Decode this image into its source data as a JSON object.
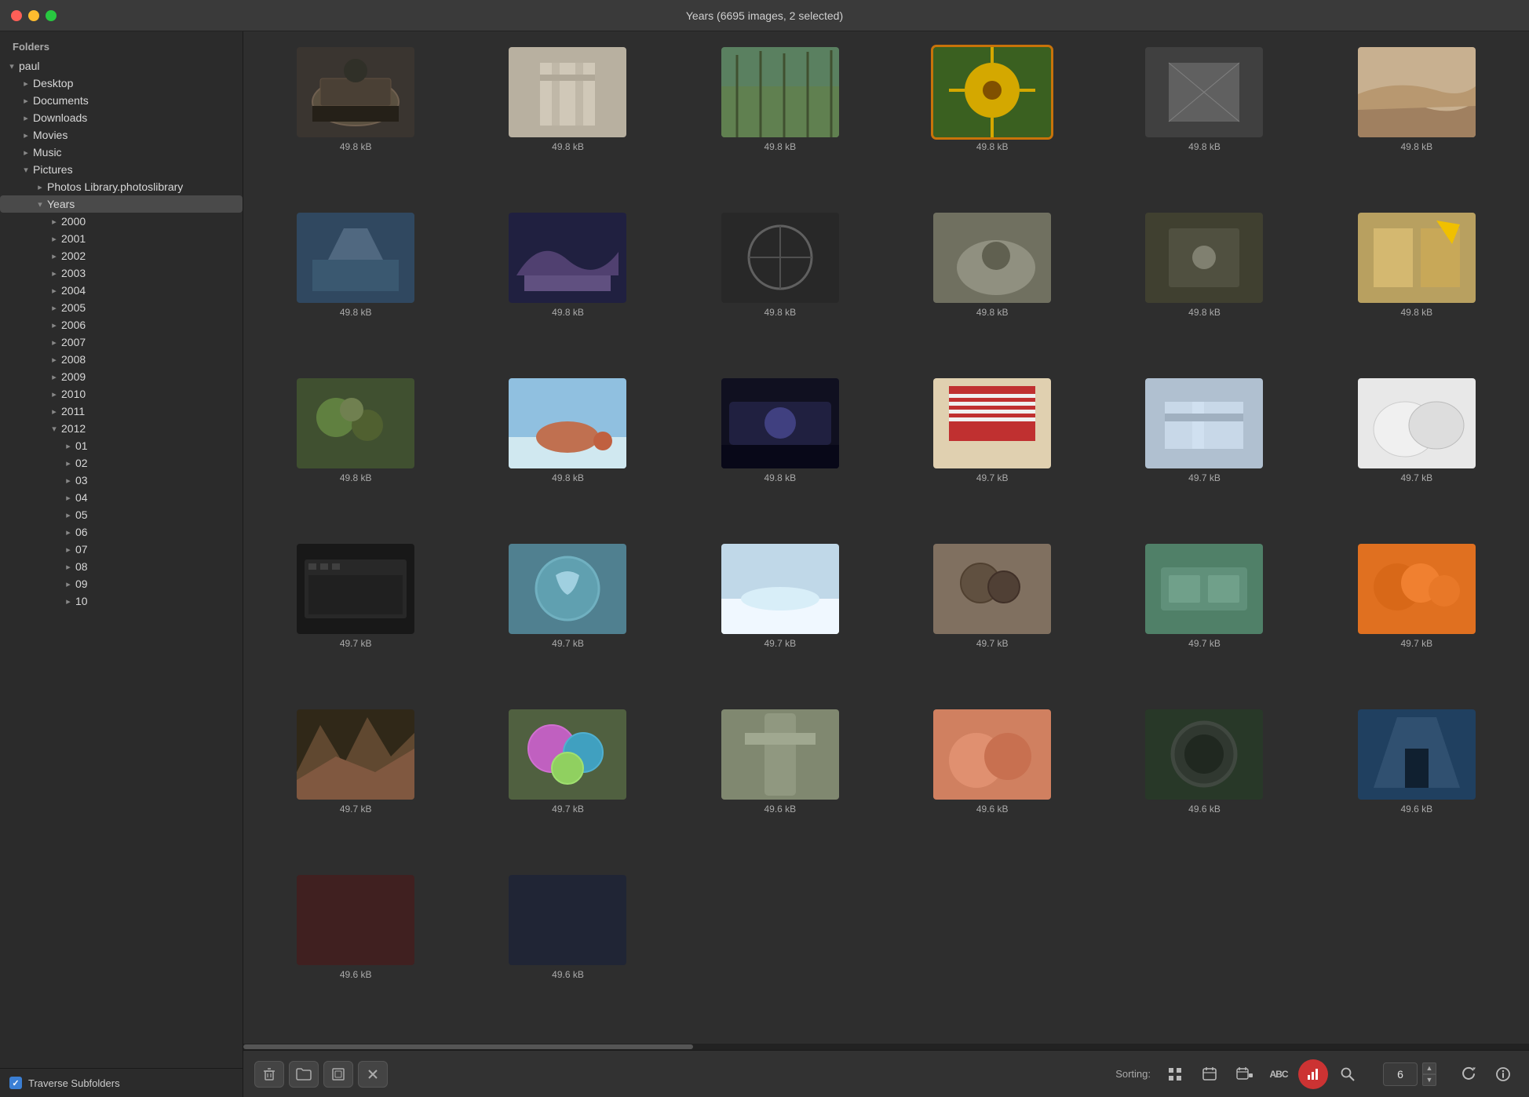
{
  "titlebar": {
    "title": "Years (6695 images, 2 selected)",
    "traffic_lights": [
      "close",
      "minimize",
      "maximize"
    ]
  },
  "sidebar": {
    "header": "Folders",
    "items": [
      {
        "id": "paul",
        "label": "paul",
        "indent": 0,
        "chevron": "open"
      },
      {
        "id": "desktop",
        "label": "Desktop",
        "indent": 1,
        "chevron": "closed"
      },
      {
        "id": "documents",
        "label": "Documents",
        "indent": 1,
        "chevron": "closed"
      },
      {
        "id": "downloads",
        "label": "Downloads",
        "indent": 1,
        "chevron": "closed"
      },
      {
        "id": "movies",
        "label": "Movies",
        "indent": 1,
        "chevron": "closed"
      },
      {
        "id": "music",
        "label": "Music",
        "indent": 1,
        "chevron": "closed"
      },
      {
        "id": "pictures",
        "label": "Pictures",
        "indent": 1,
        "chevron": "open"
      },
      {
        "id": "photos-library",
        "label": "Photos Library.photoslibrary",
        "indent": 2,
        "chevron": "closed"
      },
      {
        "id": "years",
        "label": "Years",
        "indent": 2,
        "chevron": "open",
        "selected": true
      },
      {
        "id": "y2000",
        "label": "2000",
        "indent": 3,
        "chevron": "closed"
      },
      {
        "id": "y2001",
        "label": "2001",
        "indent": 3,
        "chevron": "closed"
      },
      {
        "id": "y2002",
        "label": "2002",
        "indent": 3,
        "chevron": "closed"
      },
      {
        "id": "y2003",
        "label": "2003",
        "indent": 3,
        "chevron": "closed"
      },
      {
        "id": "y2004",
        "label": "2004",
        "indent": 3,
        "chevron": "closed"
      },
      {
        "id": "y2005",
        "label": "2005",
        "indent": 3,
        "chevron": "closed"
      },
      {
        "id": "y2006",
        "label": "2006",
        "indent": 3,
        "chevron": "closed"
      },
      {
        "id": "y2007",
        "label": "2007",
        "indent": 3,
        "chevron": "closed"
      },
      {
        "id": "y2008",
        "label": "2008",
        "indent": 3,
        "chevron": "closed"
      },
      {
        "id": "y2009",
        "label": "2009",
        "indent": 3,
        "chevron": "closed"
      },
      {
        "id": "y2010",
        "label": "2010",
        "indent": 3,
        "chevron": "closed"
      },
      {
        "id": "y2011",
        "label": "2011",
        "indent": 3,
        "chevron": "closed"
      },
      {
        "id": "y2012",
        "label": "2012",
        "indent": 3,
        "chevron": "open"
      },
      {
        "id": "m01",
        "label": "01",
        "indent": 3,
        "chevron": "closed",
        "extra_indent": true
      },
      {
        "id": "m02",
        "label": "02",
        "indent": 3,
        "chevron": "closed",
        "extra_indent": true
      },
      {
        "id": "m03",
        "label": "03",
        "indent": 3,
        "chevron": "closed",
        "extra_indent": true
      },
      {
        "id": "m04",
        "label": "04",
        "indent": 3,
        "chevron": "closed",
        "extra_indent": true
      },
      {
        "id": "m05",
        "label": "05",
        "indent": 3,
        "chevron": "closed",
        "extra_indent": true
      },
      {
        "id": "m06",
        "label": "06",
        "indent": 3,
        "chevron": "closed",
        "extra_indent": true
      },
      {
        "id": "m07",
        "label": "07",
        "indent": 3,
        "chevron": "closed",
        "extra_indent": true
      },
      {
        "id": "m08",
        "label": "08",
        "indent": 3,
        "chevron": "closed",
        "extra_indent": true
      },
      {
        "id": "m09",
        "label": "09",
        "indent": 3,
        "chevron": "closed",
        "extra_indent": true
      },
      {
        "id": "m10",
        "label": "10",
        "indent": 3,
        "chevron": "closed",
        "extra_indent": true
      }
    ],
    "footer_checkbox_label": "Traverse Subfolders"
  },
  "grid": {
    "images": [
      {
        "size": "49.8 kB",
        "selected": false,
        "bg": "#4a4a3a",
        "color": "#a09060"
      },
      {
        "size": "49.8 kB",
        "selected": false,
        "bg": "#3a3a4a",
        "color": "#7080a0"
      },
      {
        "size": "49.8 kB",
        "selected": false,
        "bg": "#3a4a3a",
        "color": "#507050"
      },
      {
        "size": "49.8 kB",
        "selected": true,
        "bg": "#806020",
        "color": "#c09030"
      },
      {
        "size": "49.8 kB",
        "selected": false,
        "bg": "#4a2a2a",
        "color": "#804040"
      },
      {
        "size": "49.8 kB",
        "selected": false,
        "bg": "#6a5040",
        "color": "#a08060"
      },
      {
        "size": "49.8 kB",
        "selected": false,
        "bg": "#304050",
        "color": "#507090"
      },
      {
        "size": "49.8 kB",
        "selected": false,
        "bg": "#303050",
        "color": "#505080"
      },
      {
        "size": "49.8 kB",
        "selected": false,
        "bg": "#303030",
        "color": "#606060"
      },
      {
        "size": "49.8 kB",
        "selected": false,
        "bg": "#504030",
        "color": "#806050"
      },
      {
        "size": "49.8 kB",
        "selected": false,
        "bg": "#303030",
        "color": "#505050"
      },
      {
        "size": "49.8 kB",
        "selected": false,
        "bg": "#404030",
        "color": "#706050"
      },
      {
        "size": "49.8 kB",
        "selected": false,
        "bg": "#304030",
        "color": "#508050"
      },
      {
        "size": "49.8 kB",
        "selected": false,
        "bg": "#304060",
        "color": "#5070a0"
      },
      {
        "size": "49.8 kB",
        "selected": false,
        "bg": "#202040",
        "color": "#404080"
      },
      {
        "size": "49.7 kB",
        "selected": false,
        "bg": "#503030",
        "color": "#805050"
      },
      {
        "size": "49.7 kB",
        "selected": false,
        "bg": "#404050",
        "color": "#607080"
      },
      {
        "size": "49.7 kB",
        "selected": false,
        "bg": "#604030",
        "color": "#a06040"
      },
      {
        "size": "49.7 kB",
        "selected": false,
        "bg": "#202020",
        "color": "#505050"
      },
      {
        "size": "49.7 kB",
        "selected": false,
        "bg": "#404535",
        "color": "#708060"
      },
      {
        "size": "49.7 kB",
        "selected": false,
        "bg": "#503530",
        "color": "#906050"
      },
      {
        "size": "49.7 kB",
        "selected": false,
        "bg": "#305050",
        "color": "#508080"
      },
      {
        "size": "49.7 kB",
        "selected": false,
        "bg": "#304060",
        "color": "#4060a0"
      },
      {
        "size": "49.7 kB",
        "selected": false,
        "bg": "#503020",
        "color": "#805030"
      },
      {
        "size": "49.7 kB",
        "selected": false,
        "bg": "#604040",
        "color": "#a06060"
      },
      {
        "size": "49.7 kB",
        "selected": false,
        "bg": "#304550",
        "color": "#507080"
      },
      {
        "size": "49.6 kB",
        "selected": false,
        "bg": "#503020",
        "color": "#906030"
      },
      {
        "size": "49.6 kB",
        "selected": false,
        "bg": "#405040",
        "color": "#608060"
      },
      {
        "size": "49.6 kB",
        "selected": false,
        "bg": "#404540",
        "color": "#607060"
      },
      {
        "size": "49.6 kB",
        "selected": false,
        "bg": "#604030",
        "color": "#a06040"
      },
      {
        "size": "49.6 kB",
        "selected": false,
        "bg": "#402020",
        "color": "#805040"
      },
      {
        "size": "49.6 kB",
        "selected": false,
        "bg": "#202535",
        "color": "#405070"
      }
    ]
  },
  "toolbar": {
    "sorting_label": "Sorting:",
    "delete_btn": "🗑",
    "folder_btn": "📁",
    "frame_btn": "⬜",
    "close_btn": "✕",
    "sort_grid": "⊞",
    "sort_calendar": "📅",
    "sort_calendar2": "📆",
    "sort_abc": "ABC",
    "sort_bars": "▊",
    "sort_search": "🔍",
    "count_value": "6",
    "refresh_btn": "↻",
    "info_btn": "ℹ"
  },
  "colors": {
    "selected_border": "#c8730a",
    "active_sort": "#cc3333",
    "sidebar_bg": "#2b2b2b",
    "content_bg": "#2e2e2e",
    "toolbar_bg": "#323232"
  }
}
